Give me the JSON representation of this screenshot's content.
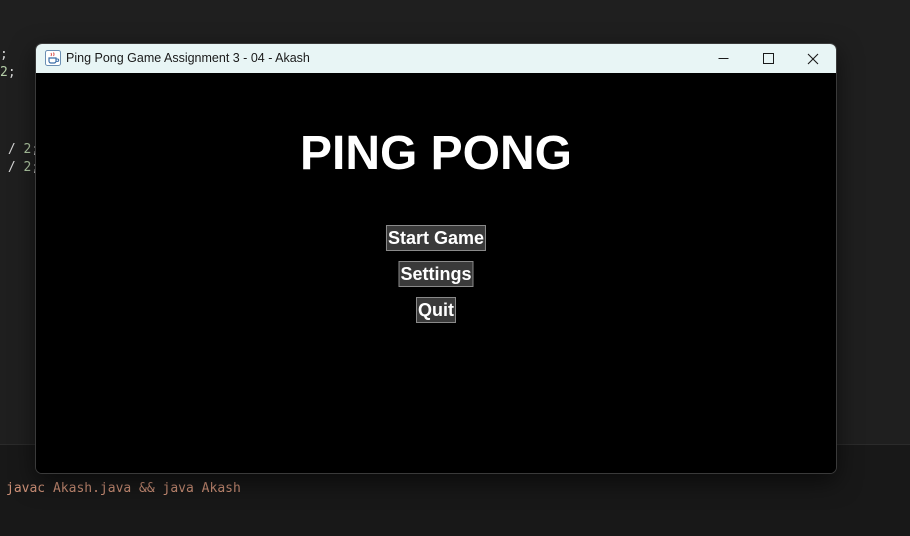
{
  "editor": {
    "lines": [
      {
        "pre": "",
        "num": "",
        "post": ";"
      },
      {
        "pre": "",
        "num": "2",
        "post": ";"
      },
      {
        "pre": " / ",
        "num": "2",
        "post": ";"
      },
      {
        "pre": " / ",
        "num": "2",
        "post": ";"
      }
    ]
  },
  "terminal": {
    "command": "javac Akash.java && java Akash"
  },
  "window": {
    "title": "Ping Pong Game Assignment 3 - 04 - Akash",
    "icon": "java-cup-icon",
    "controls": {
      "minimize": "minimize-icon",
      "maximize": "maximize-icon",
      "close": "close-icon"
    }
  },
  "game": {
    "title": "PING PONG",
    "menu": {
      "start": "Start Game",
      "settings": "Settings",
      "quit": "Quit"
    }
  },
  "colors": {
    "canvas_background": "#000000",
    "button_background": "#3a3a3a",
    "title_text": "#ffffff",
    "titlebar_background": "#e8f5f5"
  }
}
